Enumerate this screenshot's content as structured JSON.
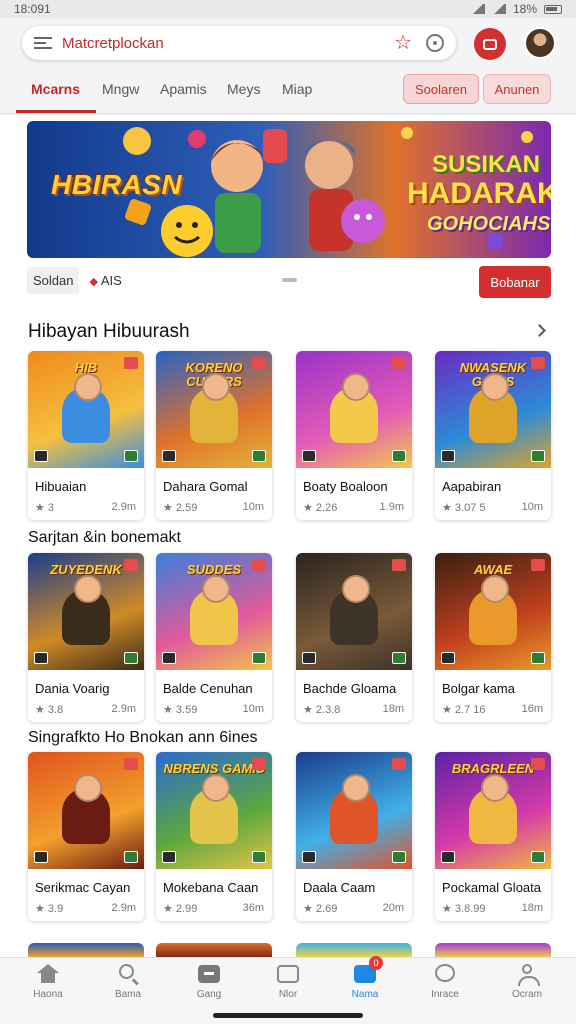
{
  "status": {
    "time": "18:091",
    "battery": "18%"
  },
  "search": {
    "text": "Matcretplockan"
  },
  "tabs": [
    {
      "label": "Mcarns",
      "active": true
    },
    {
      "label": "Mngw"
    },
    {
      "label": "Apamis"
    },
    {
      "label": "Meys"
    },
    {
      "label": "Miap"
    }
  ],
  "chips": [
    "Soolaren",
    "Anunen"
  ],
  "banner": {
    "line1": "HBIRASN",
    "line2": "SUSIKAN",
    "line3": "HADARAK.",
    "line4": "GOHOCIAHS"
  },
  "brand": {
    "label": "Soldan",
    "tag": "AIS",
    "button": "Bobanar"
  },
  "sections": [
    {
      "title": "Hibayan Hibuurash",
      "cards": [
        {
          "name": "Hibuaian",
          "rating": "★ 3",
          "size": "2.9m",
          "art": "HIB"
        },
        {
          "name": "Dahara Gomal",
          "rating": "★ 2.59",
          "size": "10m",
          "art": "KORENO CUNDRS"
        },
        {
          "name": "Boaty Boaloon",
          "rating": "★ 2.26",
          "size": "1.9m",
          "art": ""
        },
        {
          "name": "Aapabiran",
          "rating": "★ 3.07 5",
          "size": "10m",
          "art": "NWASENK GAMIS"
        }
      ]
    },
    {
      "title": "Sarjtan &in bonemakt",
      "cards": [
        {
          "name": "Dania Voarig",
          "rating": "★ 3.8",
          "size": "2.9m",
          "art": "ZUYEDENK"
        },
        {
          "name": "Balde Cenuhan",
          "rating": "★ 3.59",
          "size": "10m",
          "art": "SUDDES"
        },
        {
          "name": "Bachde Gloama",
          "rating": "★ 2.3.8",
          "size": "18m",
          "art": ""
        },
        {
          "name": "Bolgar kama",
          "rating": "★ 2.7 16",
          "size": "16m",
          "art": "AWAE"
        }
      ]
    },
    {
      "title": "Singrafkto Ho Bnokan ann 6ines",
      "cards": [
        {
          "name": "Serikmac Cayan",
          "rating": "★ 3.9",
          "size": "2.9m",
          "art": ""
        },
        {
          "name": "Mokebana Caan",
          "rating": "★ 2.99",
          "size": "36m",
          "art": "NBRENS GAMIS"
        },
        {
          "name": "Daala Caam",
          "rating": "★ 2.69",
          "size": "20m",
          "art": ""
        },
        {
          "name": "Pockamal Gloata",
          "rating": "★ 3.8.99",
          "size": "18m",
          "art": "BRAGRLEEN"
        }
      ]
    }
  ],
  "nav": [
    {
      "label": "Haona"
    },
    {
      "label": "Bama"
    },
    {
      "label": "Gang"
    },
    {
      "label": "Nlor"
    },
    {
      "label": "Nama",
      "active": true,
      "badge": "0"
    },
    {
      "label": "Inrace"
    },
    {
      "label": "Ocram"
    }
  ],
  "colors": {
    "accent": "#c62828",
    "active_nav": "#1e88e5"
  }
}
